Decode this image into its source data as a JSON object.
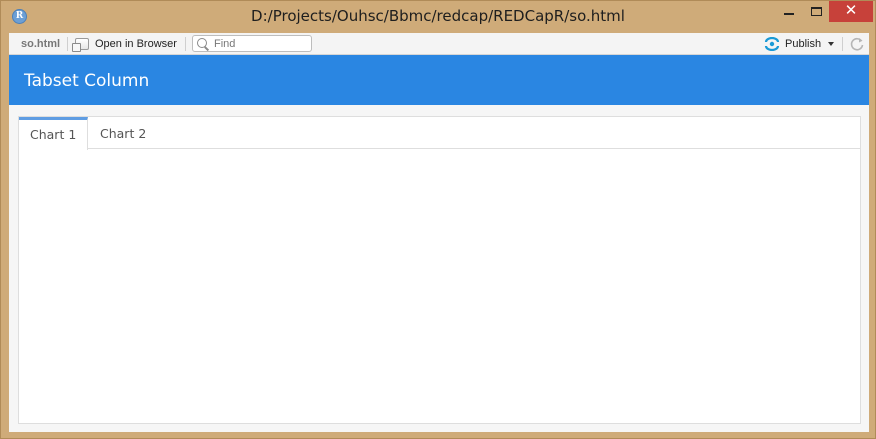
{
  "window": {
    "title": "D:/Projects/Ouhsc/Bbmc/redcap/REDCapR/so.html",
    "app_icon_letter": "R",
    "close_glyph": "✕"
  },
  "toolbar": {
    "file_name": "so.html",
    "open_in_browser_label": "Open in Browser",
    "find_placeholder": "Find",
    "publish_label": "Publish"
  },
  "app": {
    "navbar_title": "Tabset Column",
    "tabs": [
      {
        "label": "Chart 1",
        "active": true
      },
      {
        "label": "Chart 2",
        "active": false
      }
    ]
  },
  "colors": {
    "navbar": "#2a86e2",
    "active_tab_accent": "#5f9de3",
    "close_button": "#c7413a"
  }
}
